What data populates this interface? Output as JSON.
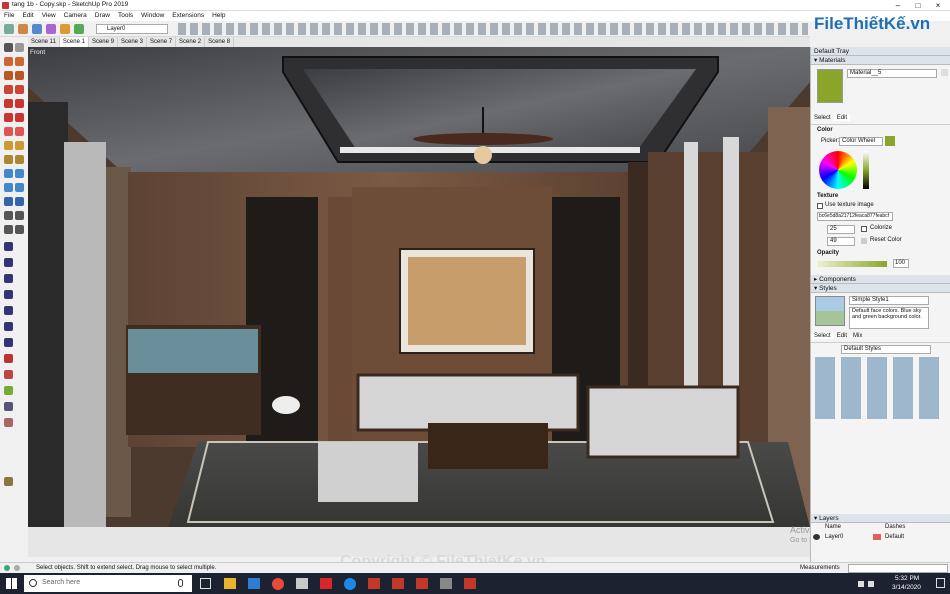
{
  "app": {
    "title": "tang 1b - Copy.skp - SketchUp Pro 2019"
  },
  "menu": [
    "File",
    "Edit",
    "View",
    "Camera",
    "Draw",
    "Tools",
    "Window",
    "Extensions",
    "Help"
  ],
  "toolbar": {
    "layer_value": "Layer0"
  },
  "scenes": [
    {
      "label": "Scene 11"
    },
    {
      "label": "Scene 1",
      "active": true
    },
    {
      "label": "Scene 9"
    },
    {
      "label": "Scene 3"
    },
    {
      "label": "Scene 7"
    },
    {
      "label": "Scene 2"
    },
    {
      "label": "Scene 8"
    }
  ],
  "viewport": {
    "view_label": "Front"
  },
  "watermark": {
    "brand": "FileThiếtKế.vn",
    "copyright": "Copyright © FileThietKe.vn",
    "activate_title": "Activate Windows",
    "activate_sub": "Go to Settings to activate Windows."
  },
  "tray": {
    "title": "Default Tray",
    "materials": {
      "header": "Materials",
      "material_name": "Material__5",
      "tabs": [
        "Select",
        "Edit"
      ],
      "color_label": "Color",
      "picker_label": "Picker:",
      "picker_value": "Color Wheel",
      "texture_label": "Texture",
      "use_texture_label": "Use texture image",
      "texture_file": "bc6e5d8a21712feaca877feabcf",
      "width_value": "25",
      "height_value": "49",
      "colorize_label": "Colorize",
      "reset_label": "Reset Color",
      "opacity_label": "Opacity",
      "opacity_value": "100"
    },
    "components": {
      "header": "Components"
    },
    "styles": {
      "header": "Styles",
      "style_name": "Simple Style1",
      "description": "Default face colors. Blue sky and green background color.",
      "tabs": [
        "Select",
        "Edit",
        "Mix"
      ],
      "collection": "Default Styles"
    },
    "layers": {
      "header": "Layers",
      "col_name": "Name",
      "col_dashes": "Dashes",
      "row_name": "Layer0",
      "row_dashes": "Default"
    }
  },
  "status": {
    "hint": "Select objects. Shift to extend select. Drag mouse to select multiple.",
    "measurements_label": "Measurements"
  },
  "taskbar": {
    "search_placeholder": "Search here",
    "time": "5:32 PM",
    "date": "3/14/2020"
  },
  "colors": {
    "material_swatch": "#8aa52a",
    "accent": "#0078d7"
  }
}
